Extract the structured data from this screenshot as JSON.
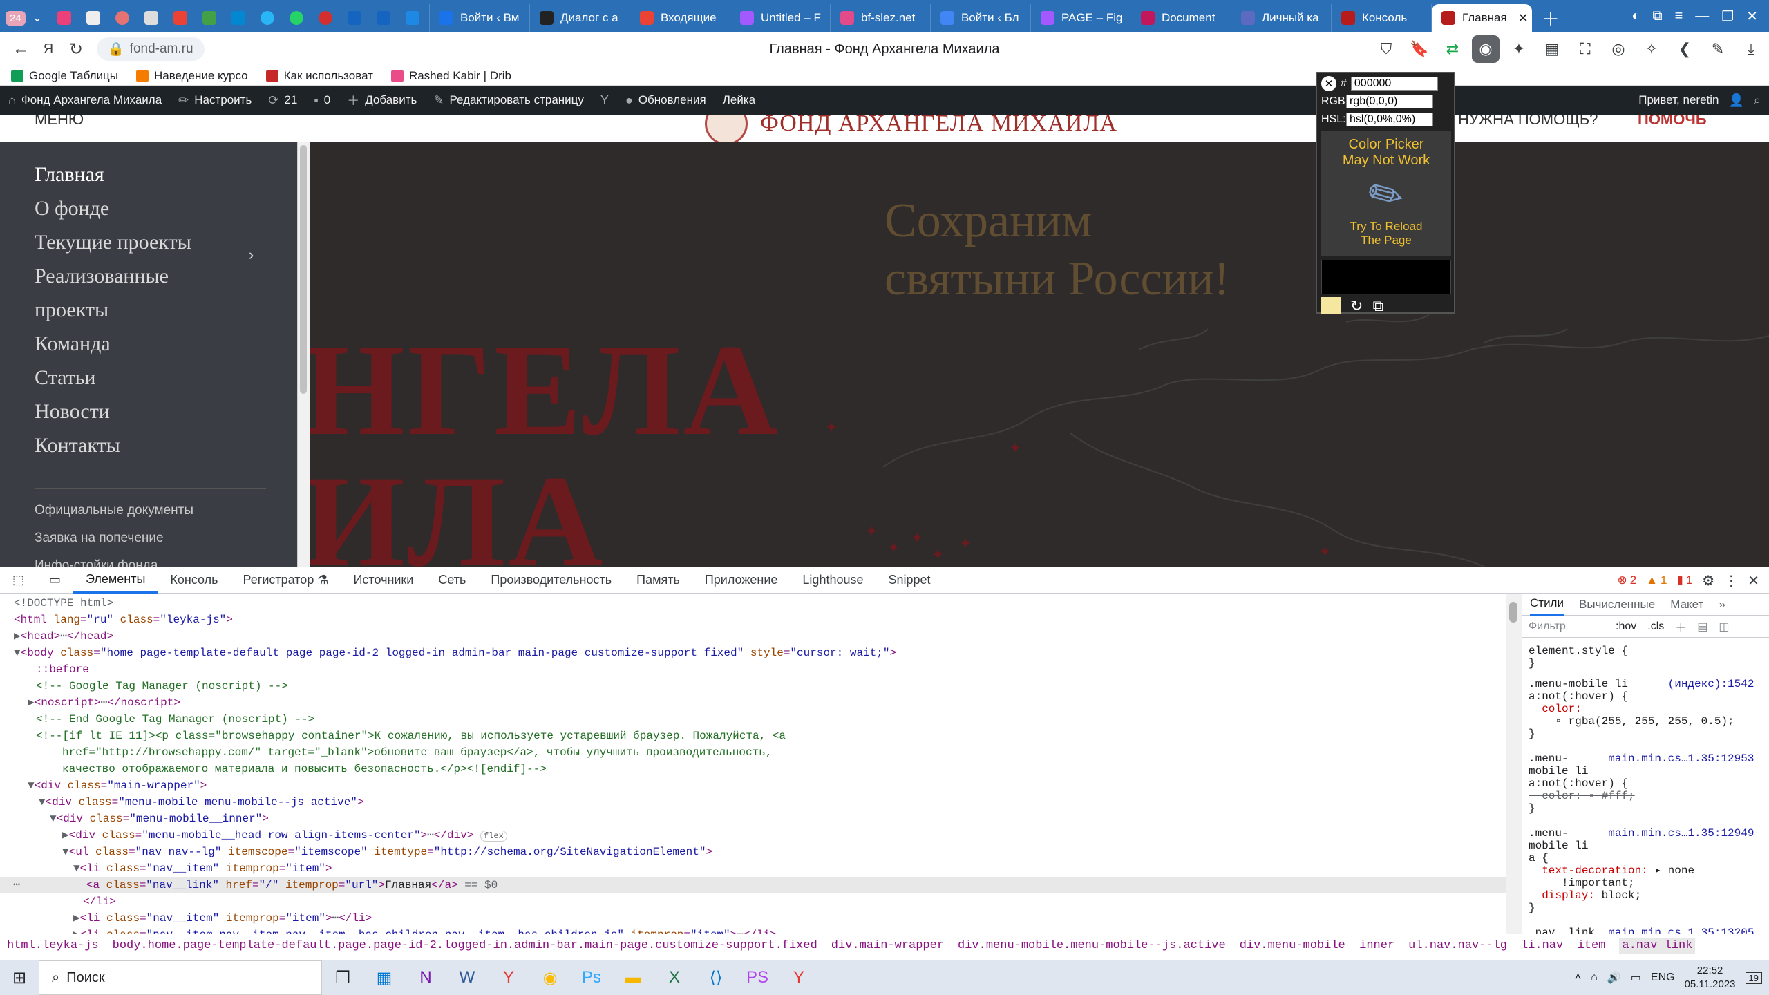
{
  "browser": {
    "tabs": [
      {
        "label": "Войти ‹ Вм",
        "color": "#1a73e8"
      },
      {
        "label": "Диалог с а",
        "color": "#222222"
      },
      {
        "label": "Входящие",
        "color": "#ea4335"
      },
      {
        "label": "Untitled – F",
        "color": "#a259ff"
      },
      {
        "label": "bf-slez.net",
        "color": "#e34a8a"
      },
      {
        "label": "Войти ‹ Бл",
        "color": "#4285f4"
      },
      {
        "label": "PAGE – Fig",
        "color": "#a259ff"
      },
      {
        "label": "Document",
        "color": "#c2185b"
      },
      {
        "label": "Личный ка",
        "color": "#5c6bc0"
      },
      {
        "label": "Консоль",
        "color": "#b71c1c"
      },
      {
        "label": "Главная",
        "color": "#b71c1c",
        "active": true
      }
    ],
    "badge_count": "24",
    "url": "fond-am.ru",
    "page_title": "Главная - Фонд Архангела Михаила",
    "bookmarks": [
      {
        "label": "Google Таблицы",
        "color": "#0f9d58"
      },
      {
        "label": "Наведение курсо",
        "color": "#f57c00"
      },
      {
        "label": "Как использоват",
        "color": "#c62828"
      },
      {
        "label": "Rashed Kabir | Drib",
        "color": "#ea4c89"
      }
    ]
  },
  "adminbar": {
    "site": "Фонд Архангела Михаила",
    "customize": "Настроить",
    "updates_count": "21",
    "comments_count": "0",
    "add": "Добавить",
    "edit": "Редактировать страницу",
    "updates": "Обновления",
    "leyka": "Лейка",
    "greeting": "Привет, neretin"
  },
  "site": {
    "menu": "МЕНЮ",
    "brand": "ФОНД АРХАНГЕЛА МИХАИЛА",
    "help": "НУЖНА ПОМОЩЬ?",
    "donate": "ПОМОЧЬ",
    "nav": [
      "Главная",
      "О фонде",
      "Текущие проекты",
      "Реализованные",
      "проекты",
      "Команда",
      "Статьи",
      "Новости",
      "Контакты"
    ],
    "nav_small": [
      "Официальные документы",
      "Заявка на попечение",
      "Инфо-стойки фонда"
    ],
    "hero_line1": "Сохраним",
    "hero_line2": "святыни России!",
    "big1": "НГЕЛА",
    "big2": "ИЛА"
  },
  "devtools": {
    "tabs": [
      "Элементы",
      "Консоль",
      "Регистратор ⚗",
      "Источники",
      "Сеть",
      "Производительность",
      "Память",
      "Приложение",
      "Lighthouse",
      "Snippet"
    ],
    "errors": "2",
    "warnings": "1",
    "issues": "1",
    "style_tabs": [
      "Стили",
      "Вычисленные",
      "Макет"
    ],
    "filter": "Фильтр",
    "hov": ":hov",
    "cls": ".cls",
    "breadcrumbs": [
      "html.leyka-js",
      "body.home.page-template-default.page.page-id-2.logged-in.admin-bar.main-page.customize-support.fixed",
      "div.main-wrapper",
      "div.menu-mobile.menu-mobile--js.active",
      "div.menu-mobile__inner",
      "ul.nav.nav--lg",
      "li.nav__item",
      "a.nav_link"
    ]
  },
  "colorpicker": {
    "hex": "000000",
    "rgb": "rgb(0,0,0)",
    "hsl": "hsl(0,0%,0%)",
    "warning": "Color Picker May Not Work",
    "hint": "Try To Reload The Page"
  },
  "taskbar": {
    "search": "Поиск",
    "lang": "ENG",
    "time": "22:52",
    "date": "05.11.2023",
    "notif": "19"
  }
}
